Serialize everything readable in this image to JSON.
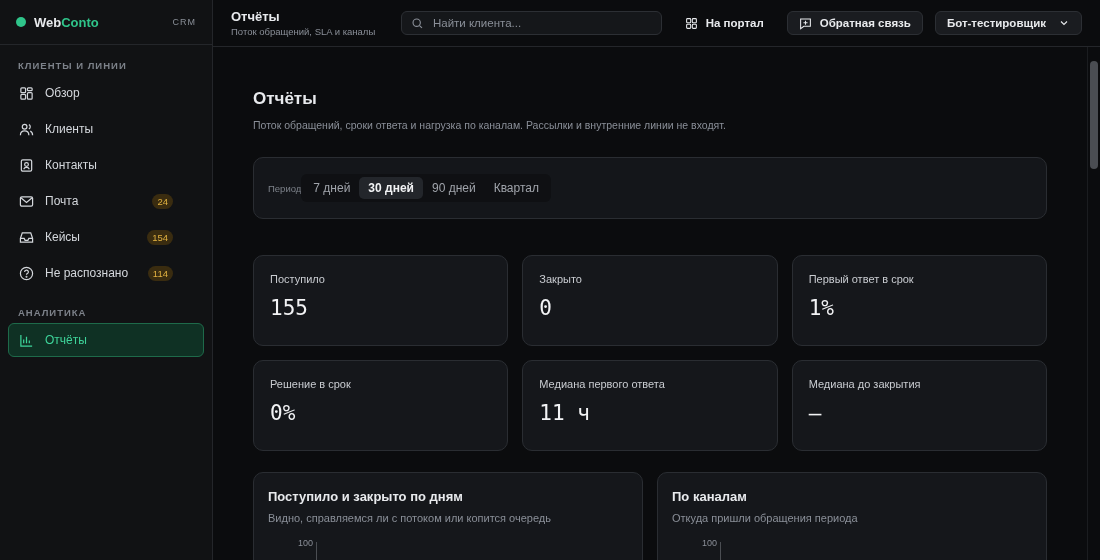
{
  "brand": {
    "name_a": "Web",
    "name_b": "Conto",
    "tag": "CRM"
  },
  "sidebar": {
    "sections": [
      {
        "title": "КЛИЕНТЫ И ЛИНИИ",
        "items": [
          {
            "label": "Обзор",
            "selected": false
          },
          {
            "label": "Клиенты",
            "selected": false
          },
          {
            "label": "Контакты",
            "selected": false
          },
          {
            "label": "Почта",
            "badge": "24",
            "selected": false
          },
          {
            "label": "Кейсы",
            "badge": "154",
            "selected": false
          },
          {
            "label": "Не распознано",
            "badge": "114",
            "selected": false
          }
        ]
      },
      {
        "title": "АНАЛИТИКА",
        "items": [
          {
            "label": "Отчёты",
            "selected": true
          }
        ]
      }
    ]
  },
  "topbar": {
    "title": "Отчёты",
    "subtitle": "Поток обращений, SLA и каналы",
    "search": {
      "placeholder": "Найти клиента..."
    },
    "portal": "На портал",
    "feedback": "Обратная связь",
    "user": "Бот-тестировщик"
  },
  "page": {
    "title": "Отчёты",
    "subtitle": "Поток обращений, сроки ответа и нагрузка по каналам. Рассылки и внутренние линии не входят."
  },
  "period": {
    "label": "Период",
    "options": [
      {
        "label": "7 дней",
        "selected": false
      },
      {
        "label": "30 дней",
        "selected": true
      },
      {
        "label": "90 дней",
        "selected": false
      },
      {
        "label": "Квартал",
        "selected": false
      }
    ]
  },
  "metrics": [
    {
      "label": "Поступило",
      "value": "155"
    },
    {
      "label": "Закрыто",
      "value": "0"
    },
    {
      "label": "Первый ответ в срок",
      "value": "1%"
    },
    {
      "label": "Решение в срок",
      "value": "0%"
    },
    {
      "label": "Медиана первого ответа",
      "value": "11 ч"
    },
    {
      "label": "Медиана до закрытия",
      "value": "—"
    }
  ],
  "charts": [
    {
      "title": "Поступило и закрыто по дням",
      "subtitle": "Видно, справляемся ли с потоком или копится очередь",
      "axis_label": "100"
    },
    {
      "title": "По каналам",
      "subtitle": "Откуда пришли обращения периода",
      "axis_label": "100"
    }
  ]
}
